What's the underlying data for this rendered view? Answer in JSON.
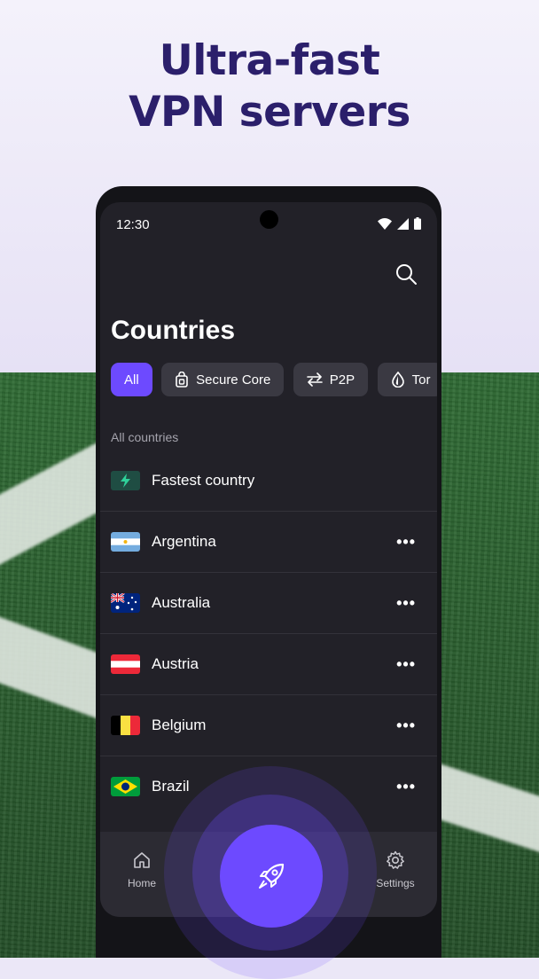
{
  "headline": {
    "line1": "Ultra-fast",
    "line2": "VPN servers"
  },
  "status_bar": {
    "time": "12:30"
  },
  "page": {
    "title": "Countries"
  },
  "filters": [
    {
      "label": "All",
      "icon": "none",
      "active": true
    },
    {
      "label": "Secure Core",
      "icon": "secure-core-icon",
      "active": false
    },
    {
      "label": "P2P",
      "icon": "p2p-arrows-icon",
      "active": false
    },
    {
      "label": "Tor",
      "icon": "onion-icon",
      "active": false
    }
  ],
  "section_label": "All countries",
  "countries": [
    {
      "name": "Fastest country",
      "flag": "lightning-icon",
      "more": ""
    },
    {
      "name": "Argentina",
      "flag": "flag-argentina",
      "more": "•••"
    },
    {
      "name": "Australia",
      "flag": "flag-australia",
      "more": "•••"
    },
    {
      "name": "Austria",
      "flag": "flag-austria",
      "more": "•••"
    },
    {
      "name": "Belgium",
      "flag": "flag-belgium",
      "more": "•••"
    },
    {
      "name": "Brazil",
      "flag": "flag-brazil",
      "more": "•••"
    }
  ],
  "bottom_nav": {
    "home": "Home",
    "settings": "Settings"
  },
  "colors": {
    "accent": "#6d4aff",
    "headline": "#2b1f6b",
    "surface": "#222128"
  }
}
